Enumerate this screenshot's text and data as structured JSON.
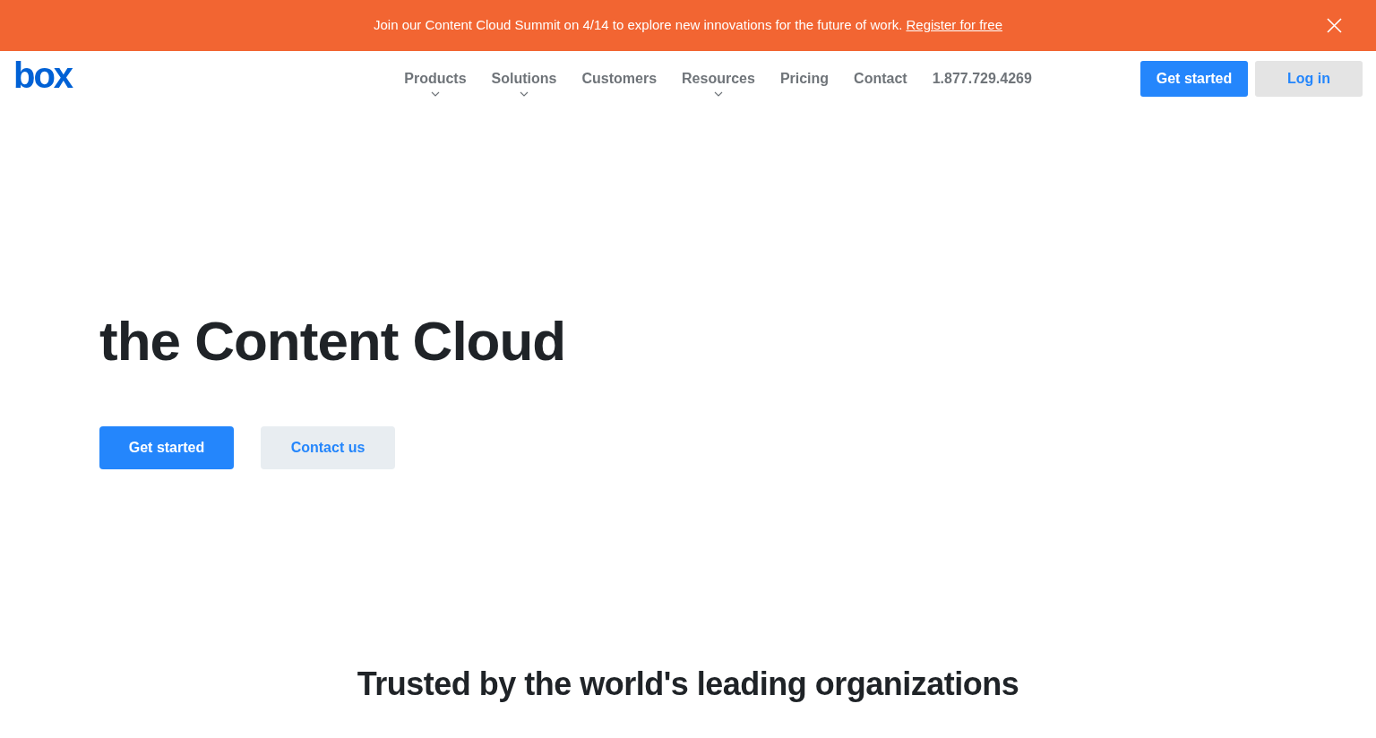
{
  "banner": {
    "text": "Join our Content Cloud Summit on 4/14 to explore new innovations for the future of work.",
    "link": "Register for free"
  },
  "logo": "box",
  "nav": [
    {
      "label": "Products",
      "dropdown": true
    },
    {
      "label": "Solutions",
      "dropdown": true
    },
    {
      "label": "Customers",
      "dropdown": false
    },
    {
      "label": "Resources",
      "dropdown": true
    },
    {
      "label": "Pricing",
      "dropdown": false
    },
    {
      "label": "Contact",
      "dropdown": false
    },
    {
      "label": "1.877.729.4269",
      "dropdown": false
    }
  ],
  "header_buttons": [
    {
      "label": "Get started",
      "kind": "primary"
    },
    {
      "label": "Log in",
      "kind": "secondary"
    }
  ],
  "hero": {
    "title": "the Content Cloud",
    "buttons": [
      {
        "label": "Get started",
        "kind": "primary"
      },
      {
        "label": "Contact us",
        "kind": "secondary"
      }
    ]
  },
  "trusted": {
    "title": "Trusted by the world's leading organizations"
  }
}
